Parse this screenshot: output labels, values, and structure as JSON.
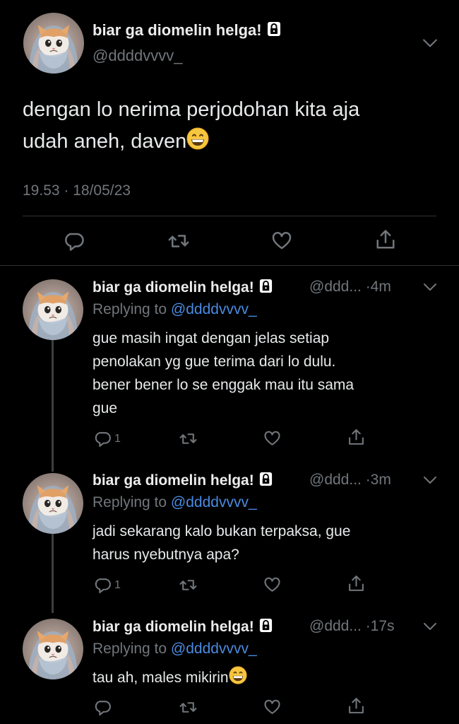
{
  "main_tweet": {
    "display_name": "biar ga diomelin helga!",
    "handle": "@ddddvvvv_",
    "text_line1": "dengan lo nerima perjodohan kita aja",
    "text_line2": "udah aneh, daven",
    "emoji": "grinning-face",
    "timestamp": "19.53 · 18/05/23"
  },
  "replies": [
    {
      "display_name": "biar ga diomelin helga!",
      "handle_time": "@ddd... ·4m",
      "replying_label": "Replying to",
      "replying_handle": "@ddddvvvv_",
      "lines": [
        "gue masih ingat dengan jelas setiap",
        "penolakan yg gue terima dari lo dulu.",
        "bener bener lo se enggak mau itu sama",
        "gue"
      ],
      "reply_count": "1"
    },
    {
      "display_name": "biar ga diomelin helga!",
      "handle_time": "@ddd... ·3m",
      "replying_label": "Replying to",
      "replying_handle": "@ddddvvvv_",
      "lines": [
        "jadi sekarang kalo bukan terpaksa, gue",
        "harus nyebutnya apa?"
      ],
      "reply_count": "1"
    },
    {
      "display_name": "biar ga diomelin helga!",
      "handle_time": "@ddd... ·17s",
      "replying_label": "Replying to",
      "replying_handle": "@ddddvvvv_",
      "lines": [
        "tau ah, males mikirin"
      ],
      "reply_count": ""
    }
  ],
  "colors": {
    "background": "#000000",
    "text": "#e7e9ea",
    "muted": "#71767b",
    "link": "#4a8ae0",
    "divider": "#2f3336"
  }
}
